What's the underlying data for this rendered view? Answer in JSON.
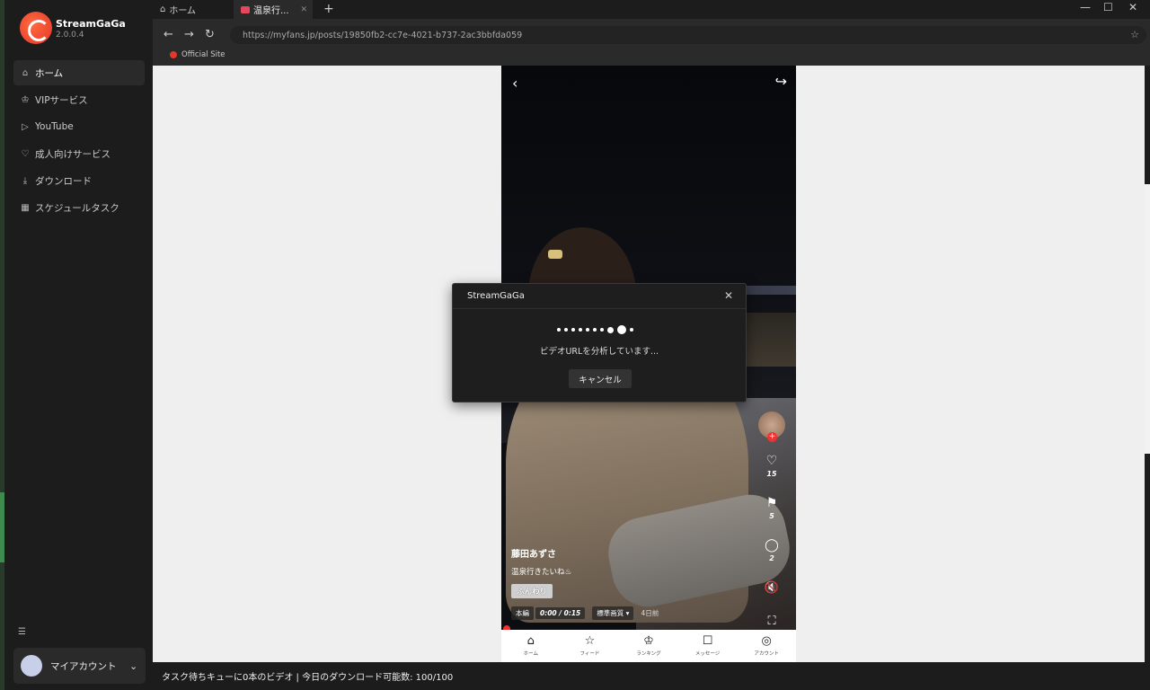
{
  "app": {
    "name": "StreamGaGa",
    "version": "2.0.0.4"
  },
  "sidebar": {
    "items": [
      {
        "label": "ホーム",
        "icon": "home-icon"
      },
      {
        "label": "VIPサービス",
        "icon": "crown-icon"
      },
      {
        "label": "YouTube",
        "icon": "youtube-icon"
      },
      {
        "label": "成人向けサービス",
        "icon": "heart-icon"
      },
      {
        "label": "ダウンロード",
        "icon": "download-icon"
      },
      {
        "label": "スケジュールタスク",
        "icon": "calendar-icon"
      }
    ],
    "account_label": "マイアカウント"
  },
  "tabs": [
    {
      "label": "ホーム",
      "icon": "home-icon"
    },
    {
      "label": "温泉行...",
      "icon": "site-favicon"
    }
  ],
  "browser": {
    "url": "https://myfans.jp/posts/19850fb2-cc7e-4021-b737-2ac3bbfda059",
    "bookmark": "Official Site"
  },
  "post": {
    "author": "藤田あずさ",
    "caption": "温泉行きたいね♨",
    "tag": "ふんわり",
    "badge": "本編",
    "time": "0:00 / 0:15",
    "quality": "標準画質 ▾",
    "age": "4日前",
    "likes": "15",
    "bookmarks": "5",
    "comments": "2"
  },
  "phone_nav": [
    {
      "label": "ホーム",
      "glyph": "⌂",
      "icon": "home-icon"
    },
    {
      "label": "フィード",
      "glyph": "☆",
      "icon": "star-icon"
    },
    {
      "label": "ランキング",
      "glyph": "♔",
      "icon": "crown-icon"
    },
    {
      "label": "メッセージ",
      "glyph": "☐",
      "icon": "message-icon"
    },
    {
      "label": "アカウント",
      "glyph": "◎",
      "icon": "user-icon"
    }
  ],
  "dialog": {
    "title": "StreamGaGa",
    "message": "ビデオURLを分析しています...",
    "cancel_label": "キャンセル"
  },
  "status_text": "タスク待ちキューに0本のビデオ | 今日のダウンロード可能数: 100/100"
}
